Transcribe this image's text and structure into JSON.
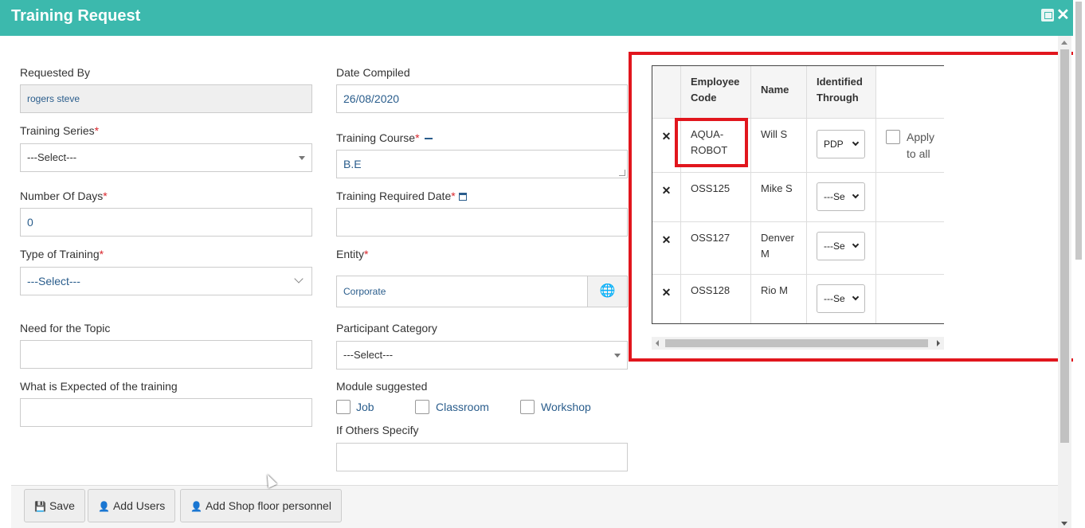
{
  "header": {
    "title": "Training Request"
  },
  "form": {
    "requested_by": {
      "label": "Requested By",
      "value": "rogers steve"
    },
    "date_compiled": {
      "label": "Date Compiled",
      "value": "26/08/2020"
    },
    "training_series": {
      "label": "Training Series",
      "value": "---Select---"
    },
    "training_course": {
      "label": "Training Course",
      "value": "B.E"
    },
    "number_of_days": {
      "label": "Number Of Days",
      "value": "0"
    },
    "training_required_date": {
      "label": "Training Required Date",
      "value": ""
    },
    "type_of_training": {
      "label": "Type of Training",
      "value": "---Select---"
    },
    "entity": {
      "label": "Entity",
      "value": "Corporate"
    },
    "need_for_topic": {
      "label": "Need for the Topic",
      "value": ""
    },
    "participant_category": {
      "label": "Participant Category",
      "value": "---Select---"
    },
    "expected": {
      "label": "What is Expected of the training",
      "value": ""
    },
    "module_suggested": {
      "label": "Module suggested",
      "options": [
        "Job",
        "Classroom",
        "Workshop"
      ]
    },
    "others_specify": {
      "label": "If Others Specify",
      "value": ""
    },
    "required_marker": "*"
  },
  "grid": {
    "headers": {
      "code": "Employee Code",
      "name": "Name",
      "identified": "Identified Through"
    },
    "delete_glyph": "✕",
    "apply_to_all": "Apply to all",
    "rows": [
      {
        "code": "AQUA-ROBOT",
        "name": "Will S",
        "identified": "PDP"
      },
      {
        "code": "OSS125",
        "name": "Mike S",
        "identified": "---Se"
      },
      {
        "code": "OSS127",
        "name": "Denver M",
        "identified": "---Se"
      },
      {
        "code": "OSS128",
        "name": "Rio M",
        "identified": "---Se"
      }
    ]
  },
  "footer": {
    "save": "Save",
    "add_users": "Add Users",
    "add_shop_floor": "Add Shop floor personnel"
  },
  "colors": {
    "header": "#3cb9ad",
    "highlight": "#e1161d",
    "required": "#d9262c",
    "link": "#2a5d8c"
  }
}
